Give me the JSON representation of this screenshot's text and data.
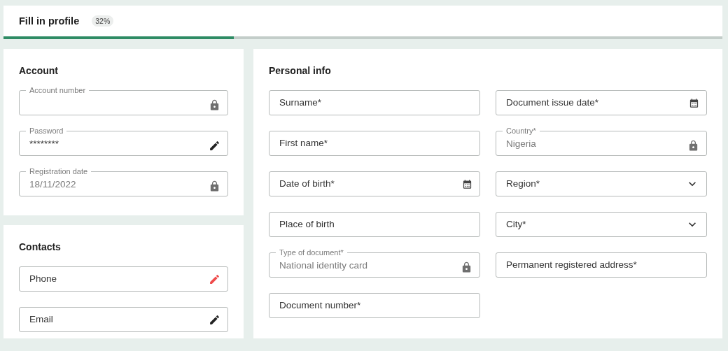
{
  "header": {
    "title": "Fill in profile",
    "percent": "32%",
    "level": 0.32
  },
  "account": {
    "title": "Account",
    "fields": [
      {
        "label": "Account number",
        "kind": "locked"
      },
      {
        "label": "Password",
        "value": "********",
        "kind": "editable",
        "alert": false
      },
      {
        "label": "Registration date",
        "value": "18/11/2022",
        "kind": "locked"
      }
    ]
  },
  "contacts": {
    "title": "Contacts",
    "fields": [
      {
        "placeholder": "Phone",
        "kind": "editable",
        "alert": true
      },
      {
        "placeholder": "Email",
        "kind": "editable",
        "alert": false
      }
    ]
  },
  "personal": {
    "title": "Personal info",
    "fields": [
      {
        "placeholder": "Surname*",
        "kind": "text"
      },
      {
        "placeholder": "First name*",
        "kind": "text"
      },
      {
        "placeholder": "Date of birth*",
        "kind": "date"
      },
      {
        "placeholder": "Place of birth",
        "kind": "text"
      },
      {
        "label": "Type of document*",
        "value": "National identity card",
        "kind": "locked"
      },
      {
        "placeholder": "Document number*",
        "kind": "text"
      },
      {
        "placeholder": "Document issue date*",
        "kind": "date"
      },
      {
        "label": "Country*",
        "value": "Nigeria",
        "kind": "locked"
      },
      {
        "placeholder": "Region*",
        "kind": "select"
      },
      {
        "placeholder": "City*",
        "kind": "select"
      },
      {
        "placeholder": "Permanent registered address*",
        "kind": "text"
      }
    ]
  }
}
